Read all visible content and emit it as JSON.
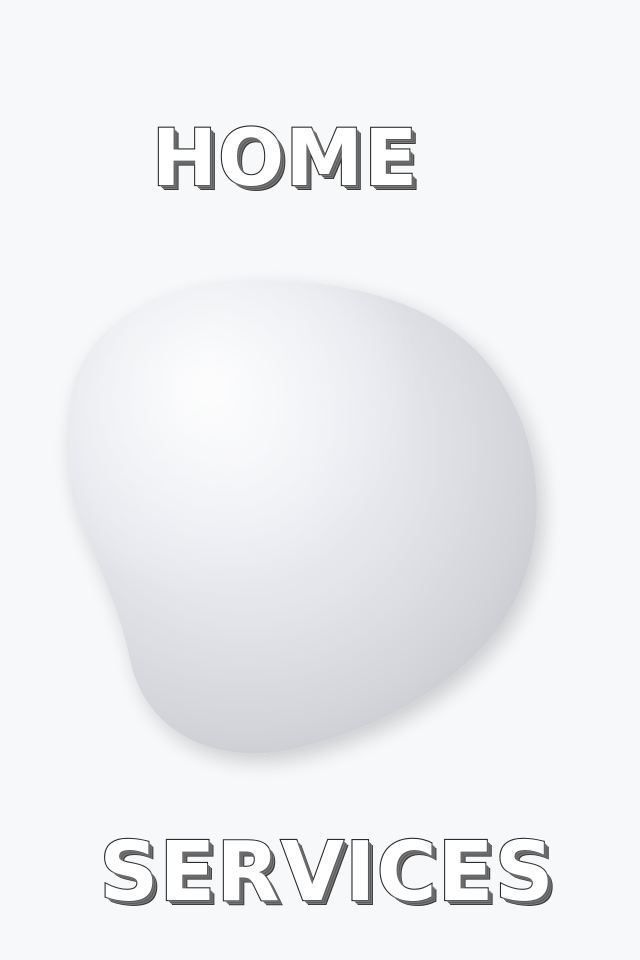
{
  "header": {
    "title": "HOME"
  },
  "footer": {
    "title": "SERVICES"
  },
  "colors": {
    "background": "#f7f8fa",
    "blob_light": "#eceef3",
    "blob_dark": "#c8c9cf",
    "outline": "#2b2b2b"
  }
}
